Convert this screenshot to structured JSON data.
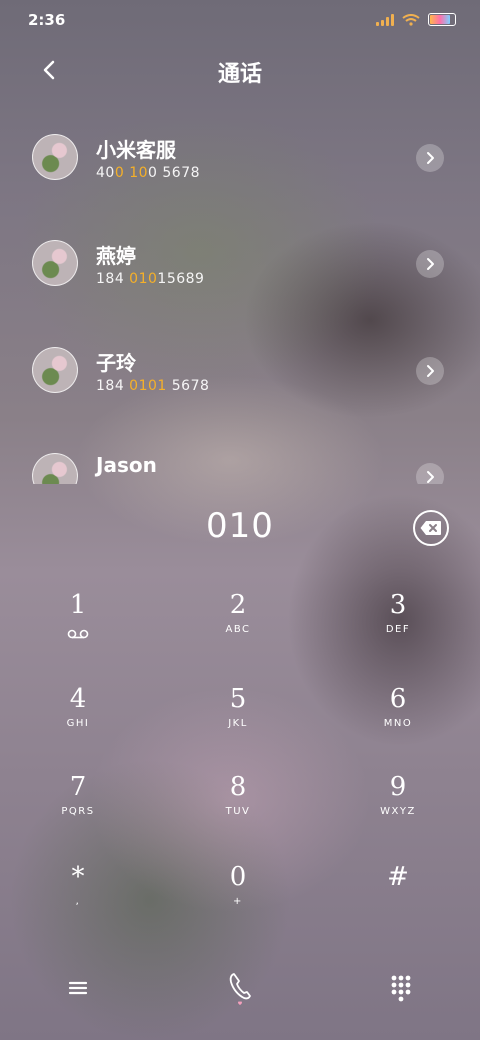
{
  "status_bar": {
    "time": "2:36",
    "signal_color": "#f0b050",
    "battery_level": 0.85
  },
  "header": {
    "title": "通话",
    "back_icon": "chevron-left-icon"
  },
  "contacts": [
    {
      "name": "小米客服",
      "number_parts": [
        "40",
        "0",
        " ",
        "10",
        "0 5678"
      ],
      "highlight": [
        false,
        true,
        false,
        true,
        false
      ]
    },
    {
      "name": "燕婷",
      "number_parts": [
        "184 ",
        "010",
        "15689"
      ],
      "highlight": [
        false,
        true,
        false
      ]
    },
    {
      "name": "子玲",
      "number_parts": [
        "184 ",
        "0101",
        " 5678"
      ],
      "highlight": [
        false,
        true,
        false
      ]
    },
    {
      "name": "Jason",
      "number_parts": [
        ""
      ],
      "highlight": [
        false
      ]
    }
  ],
  "dialer": {
    "dialed_number": "010"
  },
  "keypad": [
    {
      "digit": "1",
      "letters": "",
      "icon": "voicemail-icon"
    },
    {
      "digit": "2",
      "letters": "ABC"
    },
    {
      "digit": "3",
      "letters": "DEF"
    },
    {
      "digit": "4",
      "letters": "GHI"
    },
    {
      "digit": "5",
      "letters": "JKL"
    },
    {
      "digit": "6",
      "letters": "MNO"
    },
    {
      "digit": "7",
      "letters": "PQRS"
    },
    {
      "digit": "8",
      "letters": "TUV"
    },
    {
      "digit": "9",
      "letters": "WXYZ"
    },
    {
      "digit": "*",
      "letters": ","
    },
    {
      "digit": "0",
      "letters": "+"
    },
    {
      "digit": "#",
      "letters": ""
    }
  ],
  "colors": {
    "highlight": "#f5b029",
    "text": "#ffffff"
  }
}
